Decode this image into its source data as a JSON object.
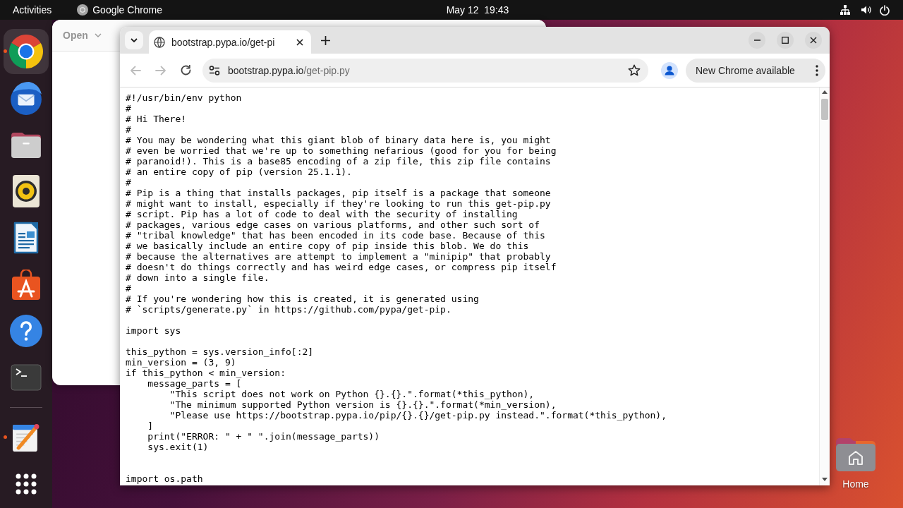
{
  "top_bar": {
    "activities": "Activities",
    "app_menu": "Google Chrome",
    "clock": "May 12  19:43"
  },
  "dock": {
    "favorites": [
      {
        "kind": "browser",
        "running": true,
        "focused": true
      },
      {
        "kind": "mail",
        "running": false,
        "focused": false
      },
      {
        "kind": "files",
        "running": false,
        "focused": false
      },
      {
        "kind": "music",
        "running": false,
        "focused": false
      },
      {
        "kind": "writer",
        "running": false,
        "focused": false
      },
      {
        "kind": "store",
        "running": false,
        "focused": false
      },
      {
        "kind": "help",
        "running": false,
        "focused": false
      },
      {
        "kind": "terminal",
        "running": false,
        "focused": false
      }
    ],
    "others": [
      {
        "kind": "editor",
        "running": true,
        "focused": false
      }
    ]
  },
  "background_window": {
    "open_button": "Open"
  },
  "browser": {
    "tabs": [
      {
        "title": "bootstrap.pypa.io/get-pi",
        "selected": true
      }
    ],
    "nav": [
      {
        "kind": "back",
        "disabled": true
      },
      {
        "kind": "forward",
        "disabled": true
      },
      {
        "kind": "reload",
        "disabled": false
      }
    ],
    "address": {
      "host": "bootstrap.pypa.io",
      "path": "/get-pip.py"
    },
    "update_chip": "New Chrome available",
    "page": {
      "source": "#!/usr/bin/env python\n#\n# Hi There!\n#\n# You may be wondering what this giant blob of binary data here is, you might\n# even be worried that we're up to something nefarious (good for you for being\n# paranoid!). This is a base85 encoding of a zip file, this zip file contains\n# an entire copy of pip (version 25.1.1).\n#\n# Pip is a thing that installs packages, pip itself is a package that someone\n# might want to install, especially if they're looking to run this get-pip.py\n# script. Pip has a lot of code to deal with the security of installing\n# packages, various edge cases on various platforms, and other such sort of\n# \"tribal knowledge\" that has been encoded in its code base. Because of this\n# we basically include an entire copy of pip inside this blob. We do this\n# because the alternatives are attempt to implement a \"minipip\" that probably\n# doesn't do things correctly and has weird edge cases, or compress pip itself\n# down into a single file.\n#\n# If you're wondering how this is created, it is generated using\n# `scripts/generate.py` in https://github.com/pypa/get-pip.\n\nimport sys\n\nthis_python = sys.version_info[:2]\nmin_version = (3, 9)\nif this_python < min_version:\n    message_parts = [\n        \"This script does not work on Python {}.{}.\".format(*this_python),\n        \"The minimum supported Python version is {}.{}.\".format(*min_version),\n        \"Please use https://bootstrap.pypa.io/pip/{}.{}/get-pip.py instead.\".format(*this_python),\n    ]\n    print(\"ERROR: \" + \" \".join(message_parts))\n    sys.exit(1)\n\n\nimport os.path"
    }
  },
  "desktop_icons": [
    {
      "label": "Home"
    }
  ]
}
